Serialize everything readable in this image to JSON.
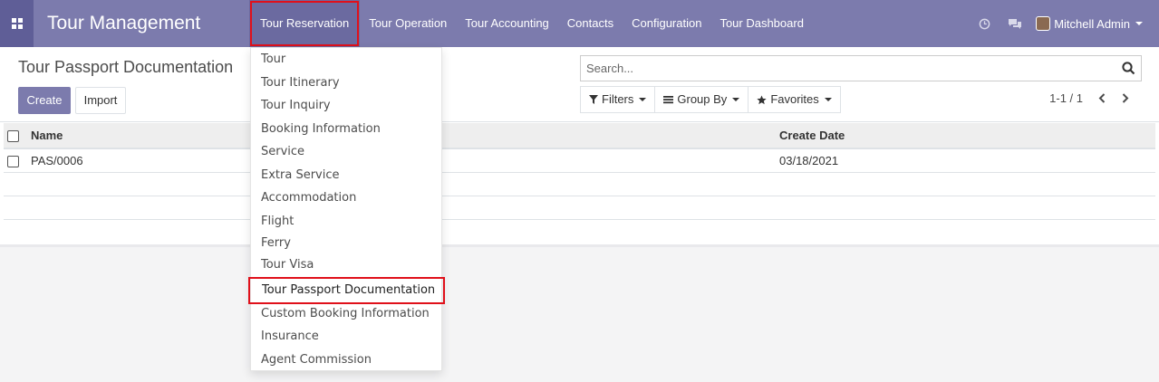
{
  "navbar": {
    "app_title": "Tour Management",
    "apps_icon": "grid-icon",
    "menu": [
      {
        "label": "Tour Reservation",
        "active": true
      },
      {
        "label": "Tour Operation"
      },
      {
        "label": "Tour Accounting"
      },
      {
        "label": "Contacts"
      },
      {
        "label": "Configuration"
      },
      {
        "label": "Tour Dashboard"
      }
    ],
    "systray": {
      "activity_icon": "clock-icon",
      "messaging_icon": "chat-icon",
      "user_name": "Mitchell Admin"
    }
  },
  "control_panel": {
    "breadcrumb": "Tour Passport Documentation",
    "create_label": "Create",
    "import_label": "Import",
    "search_placeholder": "Search...",
    "filters_label": "Filters",
    "group_by_label": "Group By",
    "favorites_label": "Favorites",
    "pager": "1-1 / 1"
  },
  "table": {
    "columns": [
      "Name",
      "Create Date"
    ],
    "rows": [
      {
        "name": "PAS/0006",
        "create_date": "03/18/2021"
      }
    ]
  },
  "dropdown": {
    "items": [
      "Tour",
      "Tour Itinerary",
      "Tour Inquiry",
      "Booking Information",
      "Service",
      "Extra Service",
      "Accommodation",
      "Flight",
      "Ferry",
      "Tour Visa",
      "Tour Passport Documentation",
      "Custom Booking Information",
      "Insurance",
      "Agent Commission"
    ],
    "highlighted_index": 10
  },
  "colors": {
    "navbar": "#7c7bad",
    "primary": "#7c7bad",
    "highlight_border": "#e0101a"
  }
}
